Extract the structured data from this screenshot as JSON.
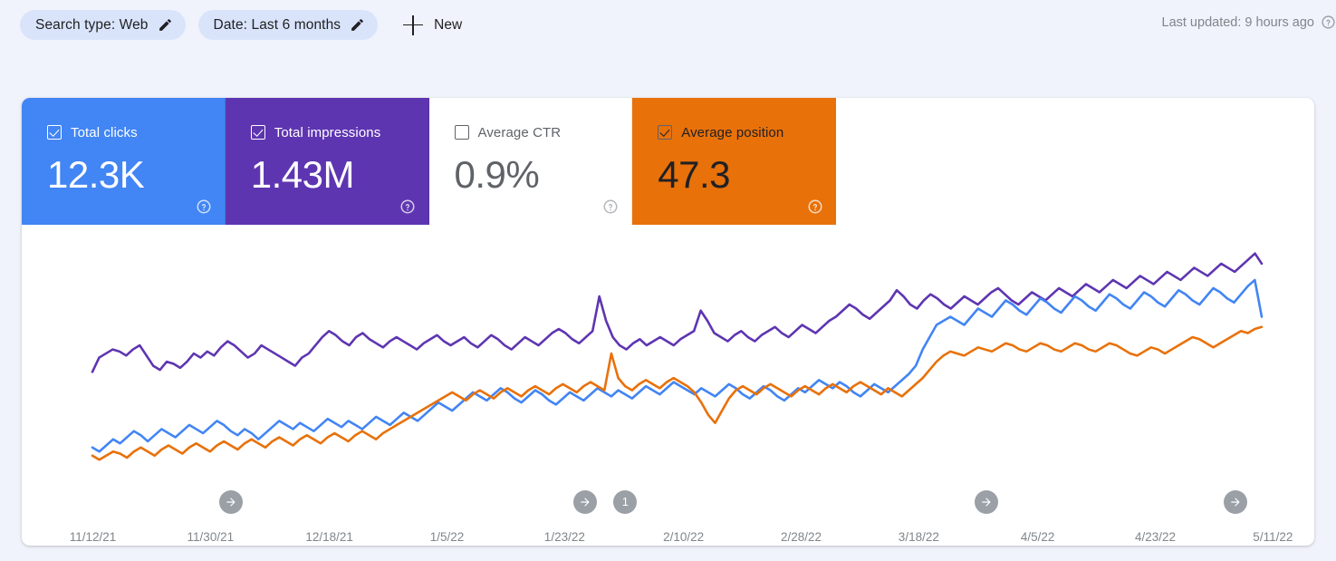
{
  "topbar": {
    "filters": [
      {
        "name": "search-type",
        "label": "Search type: Web",
        "edit_icon": "pencil-icon"
      },
      {
        "name": "date-range",
        "label": "Date: Last 6 months",
        "edit_icon": "pencil-icon"
      }
    ],
    "new_filter": {
      "label": "New",
      "icon": "plus-icon"
    },
    "last_updated": {
      "text": "Last updated: 9 hours ago",
      "icon": "help-circle-icon"
    }
  },
  "metrics": [
    {
      "key": "total_clicks",
      "label": "Total clicks",
      "value": "12.3K",
      "checked": true,
      "color": "#4285f4",
      "text_color": "#ffffff",
      "help_icon": "help-circle-icon"
    },
    {
      "key": "total_impressions",
      "label": "Total impressions",
      "value": "1.43M",
      "checked": true,
      "color": "#5e35b1",
      "text_color": "#ffffff",
      "help_icon": "help-circle-icon"
    },
    {
      "key": "average_ctr",
      "label": "Average CTR",
      "value": "0.9%",
      "checked": false,
      "color": "#ffffff",
      "text_color": "#5f6368",
      "help_icon": "help-circle-icon"
    },
    {
      "key": "average_position",
      "label": "Average position",
      "value": "47.3",
      "checked": true,
      "color": "#e8710a",
      "text_color": "#202124",
      "help_icon": "help-circle-icon"
    }
  ],
  "annotations": [
    {
      "name": "annotation-marker-1",
      "x_pct": 16.2,
      "icon": "arrow-right-icon",
      "count": null
    },
    {
      "name": "annotation-marker-2",
      "x_pct": 43.6,
      "icon": "arrow-right-icon",
      "count": null
    },
    {
      "name": "annotation-count-badge",
      "x_pct": 46.7,
      "icon": null,
      "count": "1"
    },
    {
      "name": "annotation-marker-3",
      "x_pct": 74.6,
      "icon": "arrow-right-icon",
      "count": null
    },
    {
      "name": "annotation-marker-4",
      "x_pct": 93.9,
      "icon": "arrow-right-icon",
      "count": null
    }
  ],
  "chart_data": {
    "type": "line",
    "title": "",
    "xlabel": "",
    "ylabel": "",
    "grid": false,
    "legend_position": "none",
    "x_tick_labels": [
      "11/12/21",
      "11/30/21",
      "12/18/21",
      "1/5/22",
      "1/23/22",
      "2/10/22",
      "2/28/22",
      "3/18/22",
      "4/5/22",
      "4/23/22",
      "5/11/22"
    ],
    "x_tick_pct": [
      5.5,
      14.6,
      23.8,
      32.9,
      42.0,
      51.2,
      60.3,
      69.4,
      78.6,
      87.7,
      96.8
    ],
    "x_range": [
      "11/12/21",
      "5/11/22"
    ],
    "series": [
      {
        "name": "Total impressions",
        "color": "#5e35b1",
        "values": [
          55,
          62,
          64,
          66,
          65,
          63,
          66,
          68,
          63,
          58,
          56,
          60,
          59,
          57,
          60,
          64,
          62,
          65,
          63,
          67,
          70,
          68,
          65,
          62,
          64,
          68,
          66,
          64,
          62,
          60,
          58,
          62,
          64,
          68,
          72,
          75,
          73,
          70,
          68,
          72,
          74,
          71,
          69,
          67,
          70,
          72,
          70,
          68,
          66,
          69,
          71,
          73,
          70,
          68,
          70,
          72,
          69,
          67,
          70,
          73,
          71,
          68,
          66,
          69,
          72,
          70,
          68,
          71,
          74,
          76,
          74,
          71,
          69,
          72,
          75,
          92,
          80,
          72,
          68,
          66,
          69,
          71,
          68,
          70,
          72,
          70,
          68,
          71,
          73,
          75,
          85,
          80,
          74,
          72,
          70,
          73,
          75,
          72,
          70,
          73,
          75,
          77,
          74,
          72,
          75,
          78,
          76,
          74,
          77,
          80,
          82,
          85,
          88,
          86,
          83,
          81,
          84,
          87,
          90,
          95,
          92,
          88,
          86,
          90,
          93,
          91,
          88,
          86,
          89,
          92,
          90,
          88,
          91,
          94,
          96,
          93,
          90,
          88,
          91,
          94,
          92,
          90,
          93,
          96,
          94,
          92,
          95,
          98,
          96,
          94,
          97,
          100,
          98,
          96,
          99,
          102,
          100,
          98,
          101,
          104,
          102,
          100,
          103,
          106,
          104,
          102,
          105,
          108,
          106,
          104,
          107,
          110,
          113,
          108
        ]
      },
      {
        "name": "Total clicks",
        "color": "#4285f4",
        "values": [
          18,
          16,
          19,
          22,
          20,
          23,
          26,
          24,
          21,
          24,
          27,
          25,
          23,
          26,
          29,
          27,
          25,
          28,
          31,
          29,
          26,
          24,
          27,
          25,
          22,
          25,
          28,
          31,
          29,
          27,
          30,
          28,
          26,
          29,
          32,
          30,
          28,
          31,
          29,
          27,
          30,
          33,
          31,
          29,
          32,
          35,
          33,
          31,
          34,
          37,
          40,
          38,
          36,
          39,
          42,
          45,
          43,
          41,
          44,
          47,
          45,
          42,
          40,
          43,
          46,
          44,
          41,
          39,
          42,
          45,
          43,
          41,
          44,
          47,
          45,
          43,
          46,
          44,
          42,
          45,
          48,
          46,
          44,
          47,
          50,
          48,
          46,
          44,
          47,
          45,
          43,
          46,
          49,
          47,
          44,
          42,
          45,
          48,
          46,
          43,
          41,
          44,
          47,
          45,
          48,
          51,
          49,
          47,
          50,
          48,
          45,
          43,
          46,
          49,
          47,
          45,
          48,
          51,
          54,
          58,
          66,
          72,
          78,
          80,
          82,
          80,
          78,
          82,
          86,
          84,
          82,
          86,
          90,
          88,
          85,
          83,
          87,
          91,
          89,
          86,
          84,
          88,
          92,
          90,
          87,
          85,
          89,
          93,
          91,
          88,
          86,
          90,
          94,
          92,
          89,
          87,
          91,
          95,
          93,
          90,
          88,
          92,
          96,
          94,
          91,
          89,
          93,
          97,
          100,
          82
        ]
      },
      {
        "name": "Average position",
        "color": "#e8710a",
        "values": [
          14,
          12,
          14,
          16,
          15,
          13,
          16,
          18,
          16,
          14,
          17,
          19,
          17,
          15,
          18,
          20,
          18,
          16,
          19,
          21,
          19,
          17,
          20,
          22,
          20,
          18,
          21,
          23,
          21,
          19,
          22,
          24,
          22,
          20,
          23,
          25,
          23,
          21,
          24,
          26,
          24,
          22,
          25,
          27,
          29,
          31,
          33,
          35,
          37,
          39,
          41,
          43,
          45,
          43,
          41,
          44,
          46,
          44,
          42,
          45,
          47,
          45,
          43,
          46,
          48,
          46,
          44,
          47,
          49,
          47,
          45,
          48,
          50,
          48,
          46,
          64,
          52,
          48,
          46,
          49,
          51,
          49,
          47,
          50,
          52,
          50,
          48,
          45,
          40,
          34,
          30,
          36,
          42,
          46,
          48,
          46,
          44,
          47,
          49,
          47,
          45,
          43,
          46,
          48,
          46,
          44,
          47,
          49,
          47,
          45,
          48,
          50,
          48,
          46,
          44,
          47,
          45,
          43,
          46,
          49,
          52,
          56,
          60,
          63,
          65,
          64,
          63,
          65,
          67,
          66,
          65,
          67,
          69,
          68,
          66,
          65,
          67,
          69,
          68,
          66,
          65,
          67,
          69,
          68,
          66,
          65,
          67,
          69,
          68,
          66,
          64,
          63,
          65,
          67,
          66,
          64,
          66,
          68,
          70,
          72,
          71,
          69,
          67,
          69,
          71,
          73,
          75,
          74,
          76,
          77
        ]
      }
    ]
  }
}
